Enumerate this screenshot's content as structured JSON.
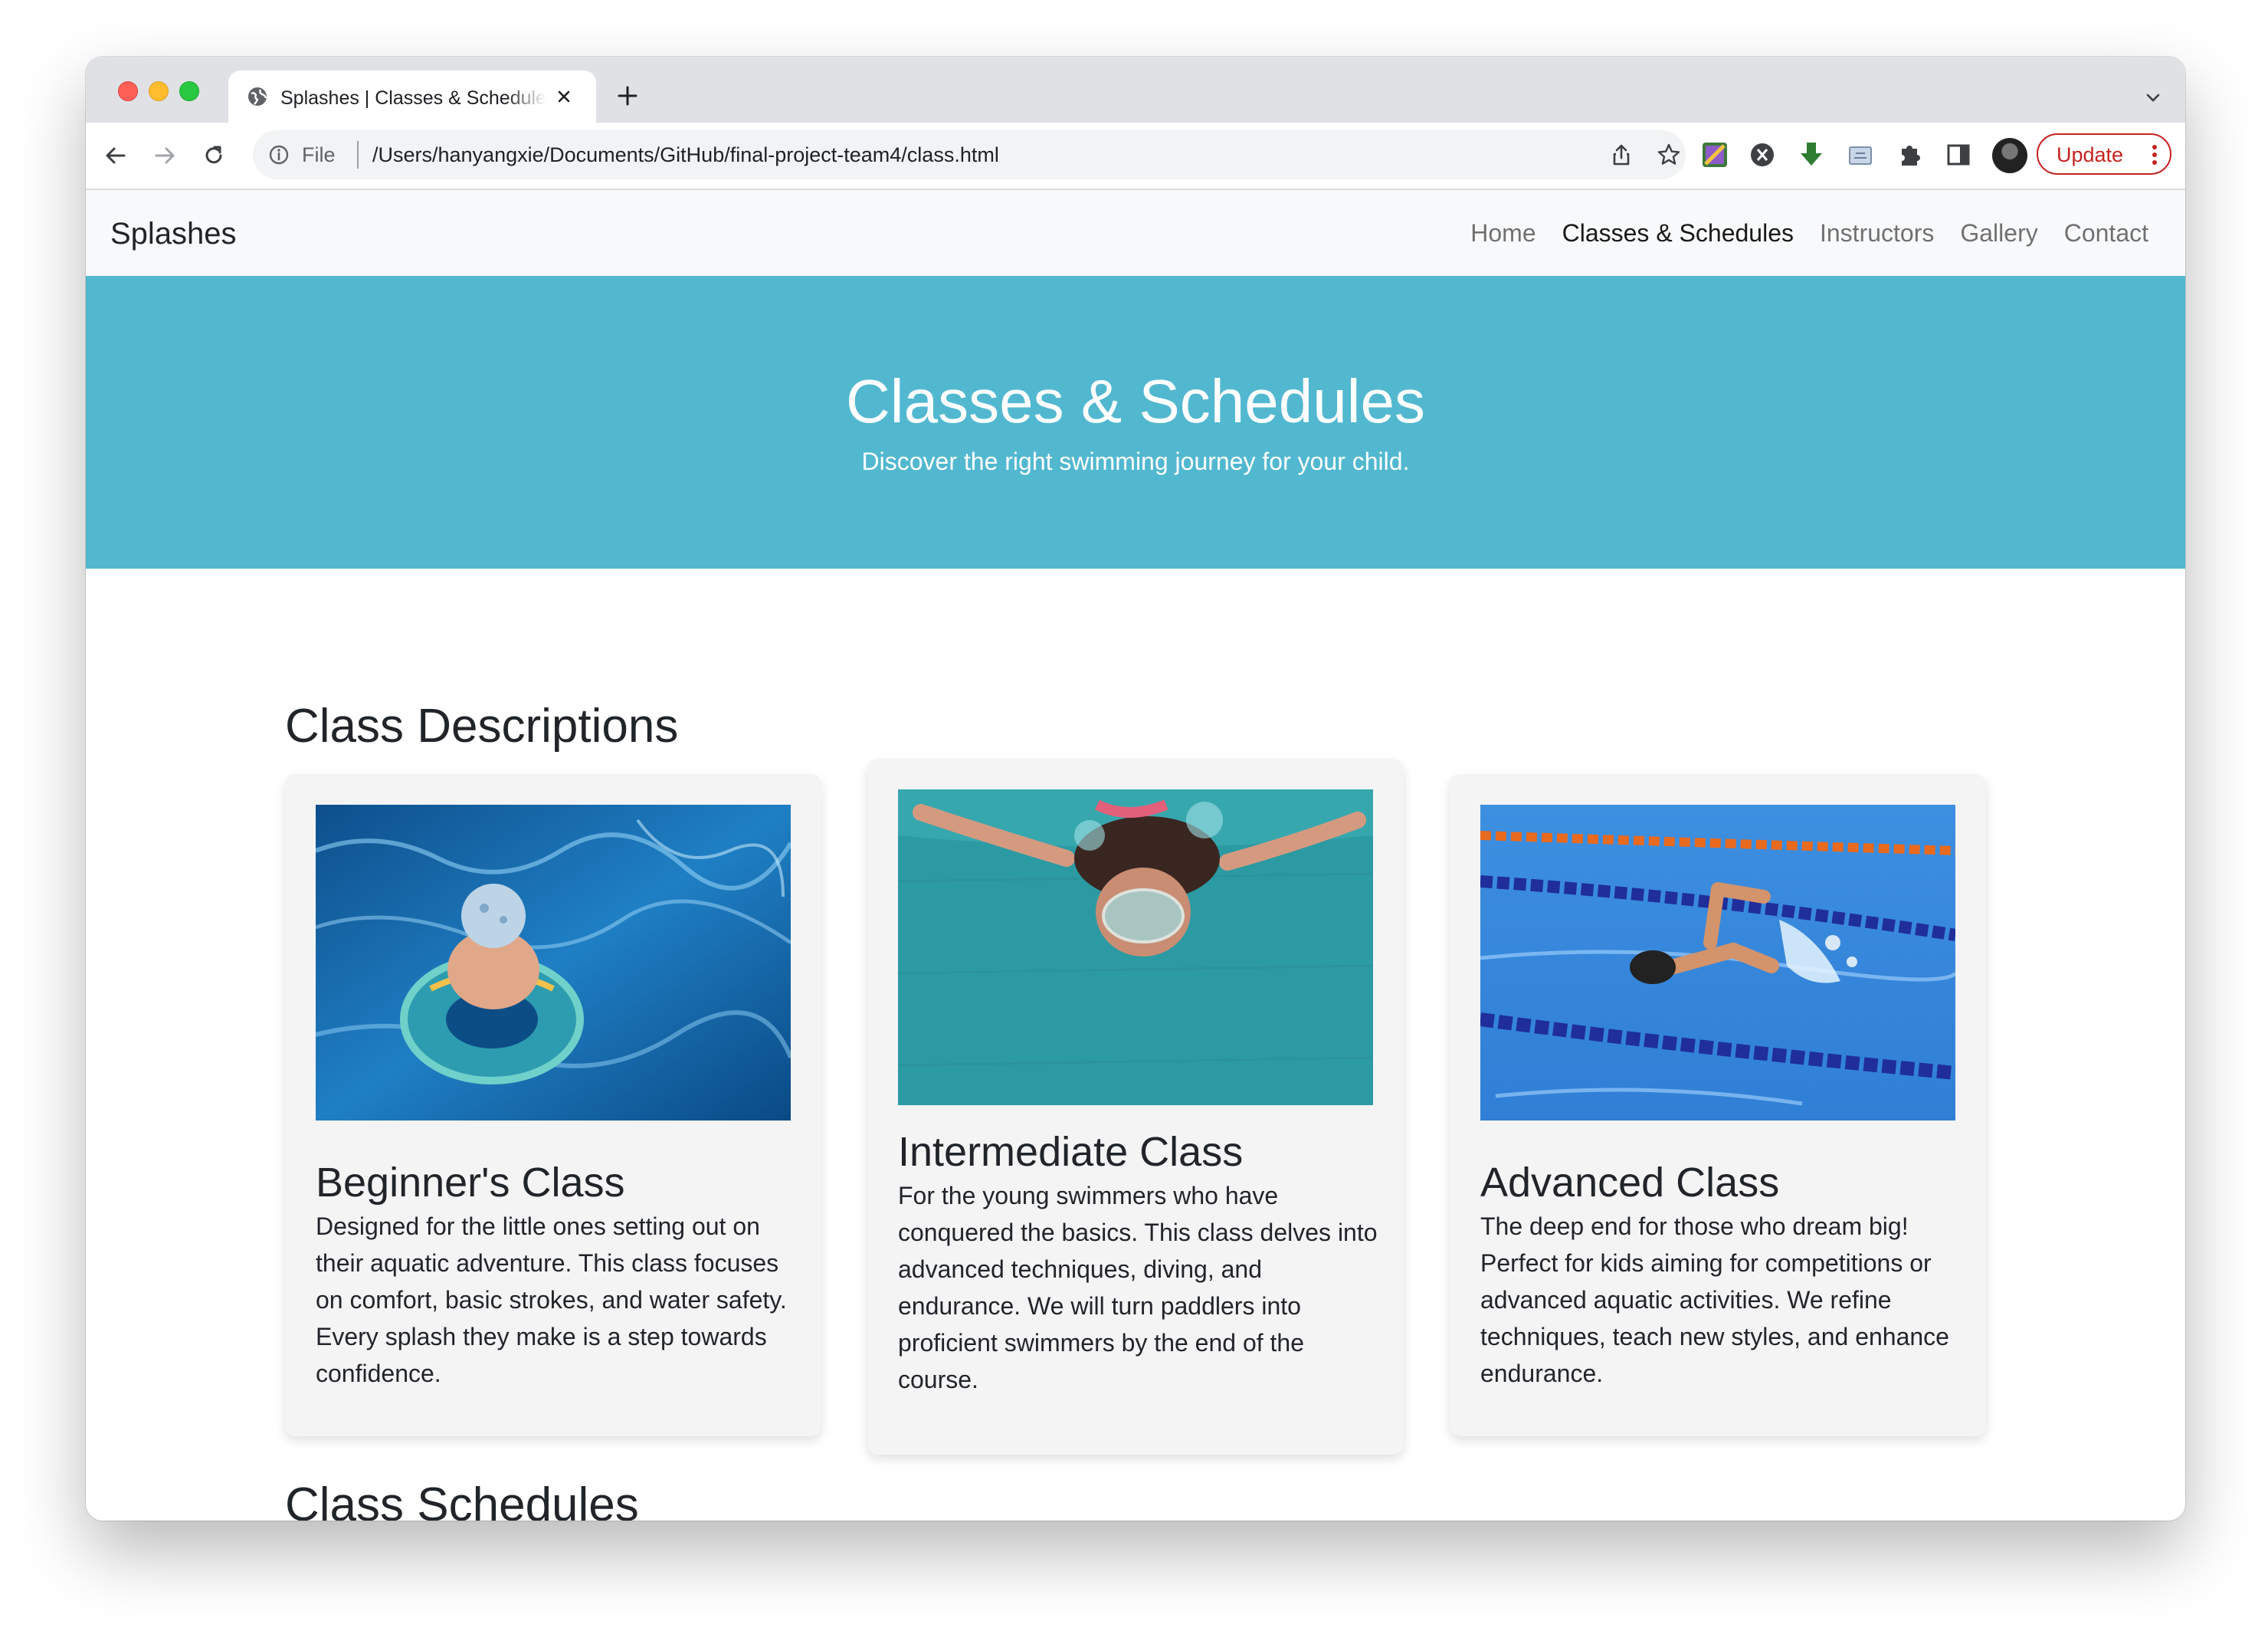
{
  "browser": {
    "tab_title": "Splashes | Classes & Schedules",
    "omnibox_prefix": "File",
    "url": "/Users/hanyangxie/Documents/GitHub/final-project-team4/class.html",
    "update_label": "Update",
    "update_color": "#c5221f"
  },
  "site": {
    "brand": "Splashes",
    "nav": [
      {
        "label": "Home",
        "active": false
      },
      {
        "label": "Classes & Schedules",
        "active": true
      },
      {
        "label": "Instructors",
        "active": false
      },
      {
        "label": "Gallery",
        "active": false
      },
      {
        "label": "Contact",
        "active": false
      }
    ]
  },
  "hero": {
    "title": "Classes & Schedules",
    "subtitle": "Discover the right swimming journey for your child.",
    "background": "#52b8d0"
  },
  "descriptions": {
    "heading": "Class Descriptions",
    "cards": [
      {
        "title": "Beginner's Class",
        "text": "Designed for the little ones setting out on their aquatic adventure. This class focuses on comfort, basic strokes, and water safety. Every splash they make is a step towards confidence.",
        "image": "child-with-swim-ring-photo"
      },
      {
        "title": "Intermediate Class",
        "text": "For the young swimmers who have conquered the basics. This class delves into advanced techniques, diving, and endurance. We will turn paddlers into proficient swimmers by the end of the course.",
        "image": "girl-swimming-underwater-photo"
      },
      {
        "title": "Advanced Class",
        "text": "The deep end for those who dream big! Perfect for kids aiming for competitions or advanced aquatic activities. We refine techniques, teach new styles, and enhance endurance.",
        "image": "freestyle-swimmer-lane-photo"
      }
    ]
  },
  "schedules": {
    "heading": "Class Schedules"
  }
}
